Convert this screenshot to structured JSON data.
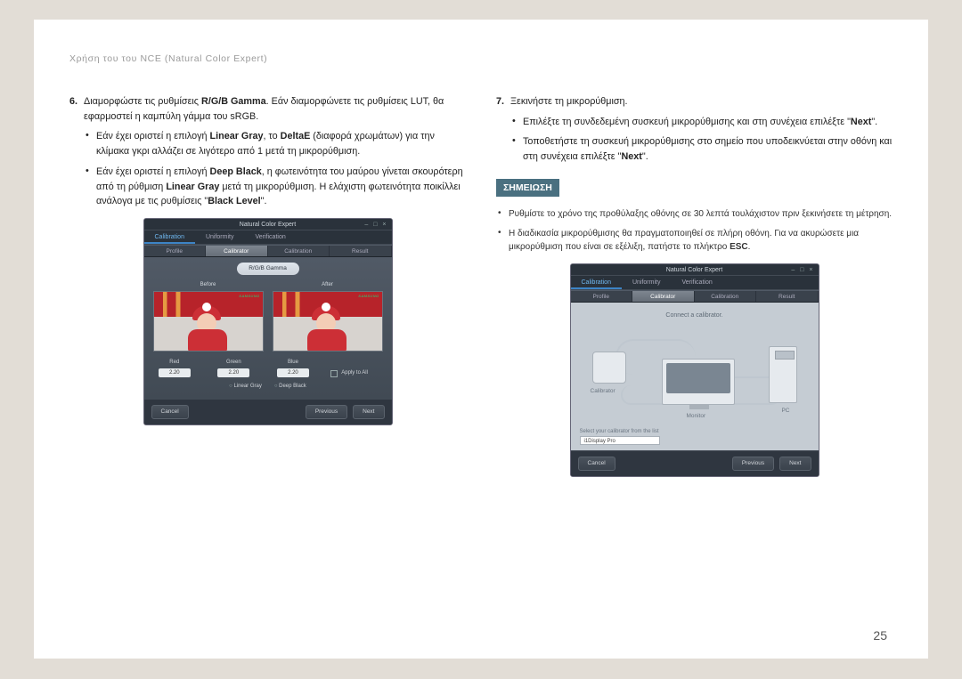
{
  "header": "Χρήση του του NCE (Natural Color Expert)",
  "pagenum": "25",
  "col1": {
    "step_num": "6.",
    "step_a": "Διαμορφώστε τις ρυθμίσεις ",
    "step_b": "R/G/B Gamma",
    "step_c": ". Εάν διαμορφώνετε τις ρυθμίσεις LUT, θα εφαρμοστεί η καμπύλη γάμμα του sRGB.",
    "b1a": "Εάν έχει οριστεί η επιλογή ",
    "b1b": "Linear Gray",
    "b1c": ", το ",
    "b1d": "DeltaE",
    "b1e": " (διαφορά χρωμάτων) για την κλίμακα γκρι αλλάζει σε λιγότερο από 1 μετά τη μικρορύθμιση.",
    "b2a": "Εάν έχει οριστεί η επιλογή ",
    "b2b": "Deep Black",
    "b2c": ", η φωτεινότητα του μαύρου γίνεται σκουρότερη από τη ρύθμιση ",
    "b2d": "Linear Gray",
    "b2e": " μετά τη μικρορύθμιση. Η ελάχιστη φωτεινότητα ποικίλλει ανάλογα με τις ρυθμίσεις \"",
    "b2f": "Black Level",
    "b2g": "\"."
  },
  "shot1": {
    "title": "Natural Color Expert",
    "tabs": [
      "Calibration",
      "Uniformity",
      "Verification"
    ],
    "subtabs": [
      "Profile",
      "Calibrator",
      "Calibration",
      "Result"
    ],
    "pill": "R/G/B Gamma",
    "caps": [
      "Before",
      "After"
    ],
    "logo": "SAMSUNG",
    "ft_labels": [
      "Red",
      "Green",
      "Blue"
    ],
    "ft_vals": [
      "2.20",
      "2.20",
      "2.20"
    ],
    "apply": "Apply to All",
    "opts": [
      "Linear Gray",
      "Deep Black"
    ],
    "btn_cancel": "Cancel",
    "btn_prev": "Previous",
    "btn_next": "Next"
  },
  "col2": {
    "step_num": "7.",
    "step": "Ξεκινήστε τη μικρορύθμιση.",
    "b1a": "Επιλέξτε τη συνδεδεμένη συσκευή μικρορύθμισης και στη συνέχεια επιλέξτε \"",
    "b1b": "Next",
    "b1c": "\".",
    "b2a": "Τοποθετήστε τη συσκευή μικρορύθμισης στο σημείο που υποδεικνύεται στην οθόνη και στη συνέχεια επιλέξτε \"",
    "b2b": "Next",
    "b2c": "\".",
    "note_label": "ΣΗΜΕΙΩΣΗ",
    "n1": "Ρυθμίστε το χρόνο της προθύλαξης οθόνης σε 30 λεπτά τουλάχιστον πριν ξεκινήσετε τη μέτρηση.",
    "n2a": "Η διαδικασία μικρορύθμισης θα πραγματοποιηθεί σε πλήρη οθόνη. Για να ακυρώσετε μια μικρορύθμιση που είναι σε εξέλιξη, πατήστε το πλήκτρο ",
    "n2b": "ESC",
    "n2c": "."
  },
  "shot2": {
    "title": "Natural Color Expert",
    "tabs": [
      "Calibration",
      "Uniformity",
      "Verification"
    ],
    "subtabs": [
      "Profile",
      "Calibrator",
      "Calibration",
      "Result"
    ],
    "connect": "Connect a calibrator.",
    "labels": {
      "cal": "Calibrator",
      "mon": "Monitor",
      "pc": "PC"
    },
    "sel_label": "Select your calibrator from the list",
    "sel_value": "i1Display Pro",
    "btn_cancel": "Cancel",
    "btn_prev": "Previous",
    "btn_next": "Next"
  }
}
